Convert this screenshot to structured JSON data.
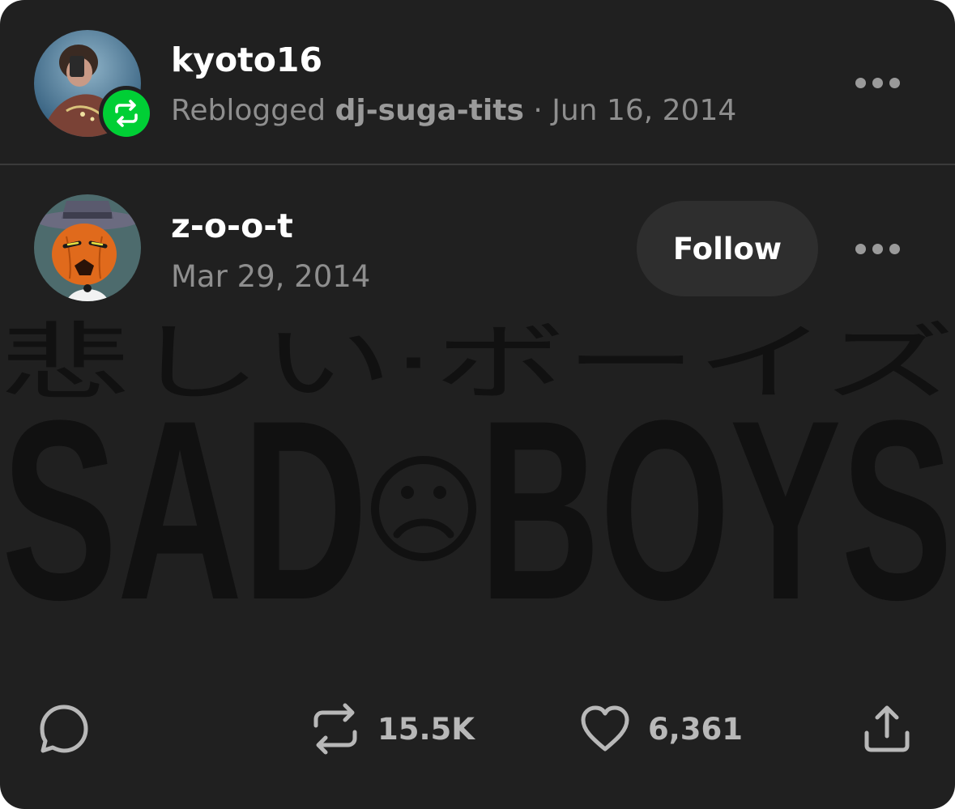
{
  "reblog": {
    "username": "kyoto16",
    "action_label": "Reblogged",
    "source_blog": "dj-suga-tits",
    "separator": "·",
    "date": "Jun 16, 2014",
    "avatar_icon": "user-photo-avatar",
    "badge_icon": "reblog-icon",
    "badge_color": "#00cf35"
  },
  "post": {
    "username": "z-o-o-t",
    "date": "Mar 29, 2014",
    "follow_label": "Follow",
    "avatar_icon": "pumpkin-character-avatar",
    "image": {
      "top_text": "悲しい·ボーイズ",
      "word_left": "SAD",
      "word_right": "BOYS",
      "logo_icon": "sad-face-icon"
    }
  },
  "actions": {
    "reply_icon": "speech-bubble-icon",
    "reblog_icon": "reblog-icon",
    "reblog_count": "15.5K",
    "like_icon": "heart-icon",
    "like_count": "6,361",
    "share_icon": "share-upload-icon"
  },
  "colors": {
    "background": "#202020",
    "muted_text": "#8e8e8e",
    "divider": "#3a3a3a",
    "follow_bg": "#2e2e2e"
  }
}
